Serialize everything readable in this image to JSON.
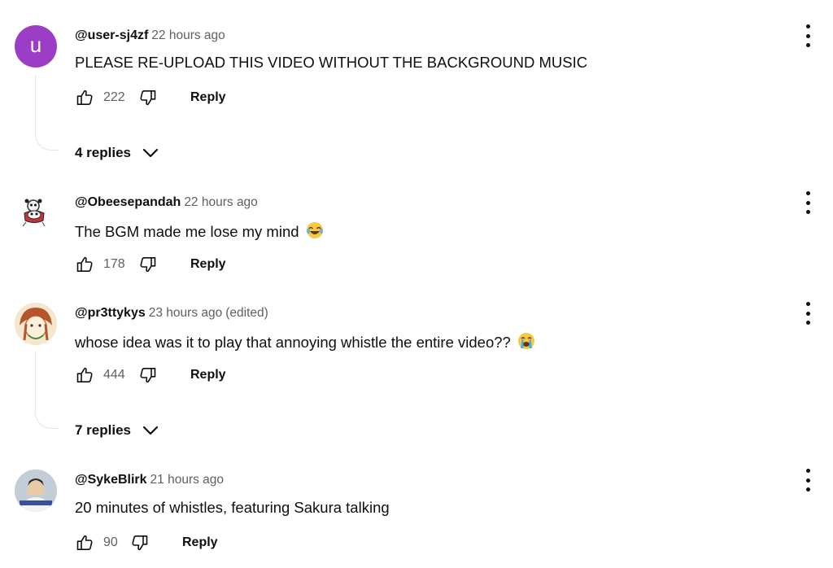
{
  "comments": [
    {
      "author": "@user-sj4zf",
      "time": "22 hours ago",
      "edited": "",
      "text": "PLEASE RE-UPLOAD THIS VIDEO WITHOUT THE BACKGROUND MUSIC",
      "likes": "222",
      "reply_label": "Reply",
      "replies_label": "4 replies",
      "avatar_letter": "u",
      "avatar_color": "#9c3dc6"
    },
    {
      "author": "@Obeesepandah",
      "time": "22 hours ago",
      "edited": "",
      "text": "The BGM made me lose my mind",
      "text_emoji": "laughing-tears-emoji",
      "likes": "178",
      "reply_label": "Reply"
    },
    {
      "author": "@pr3ttykys",
      "time": "23 hours ago",
      "edited": "(edited)",
      "text": "whose idea was it to play that annoying whistle the entire video??",
      "text_emoji": "crying-emoji",
      "likes": "444",
      "reply_label": "Reply",
      "replies_label": "7 replies"
    },
    {
      "author": "@SykeBlirk",
      "time": "21 hours ago",
      "edited": "",
      "text": "20 minutes of whistles, featuring Sakura talking",
      "likes": "90",
      "reply_label": "Reply"
    }
  ],
  "icons": {
    "like": "thumbs-up-icon",
    "dislike": "thumbs-down-icon",
    "menu": "vertical-dots-icon",
    "expand": "chevron-down-icon"
  }
}
